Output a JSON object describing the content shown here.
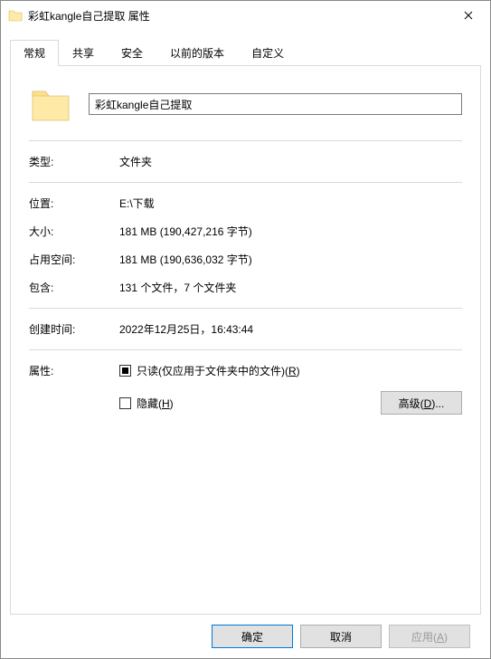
{
  "window": {
    "title": "彩虹kangle自己提取 属性"
  },
  "tabs": {
    "general": "常规",
    "share": "共享",
    "security": "安全",
    "previous": "以前的版本",
    "custom": "自定义"
  },
  "folder_name": "彩虹kangle自己提取",
  "labels": {
    "type": "类型:",
    "location": "位置:",
    "size": "大小:",
    "size_on_disk": "占用空间:",
    "contains": "包含:",
    "created": "创建时间:",
    "attributes": "属性:"
  },
  "values": {
    "type": "文件夹",
    "location": "E:\\下载",
    "size": "181 MB (190,427,216 字节)",
    "size_on_disk": "181 MB (190,636,032 字节)",
    "contains": "131 个文件，7 个文件夹",
    "created": "2022年12月25日，16:43:44"
  },
  "attributes": {
    "readonly_label_pre": "只读(仅应用于文件夹中的文件)(",
    "readonly_key": "R",
    "readonly_label_post": ")",
    "hidden_label_pre": "隐藏(",
    "hidden_key": "H",
    "hidden_label_post": ")",
    "advanced_pre": "高级(",
    "advanced_key": "D",
    "advanced_post": ")..."
  },
  "footer": {
    "ok": "确定",
    "cancel": "取消",
    "apply_pre": "应用(",
    "apply_key": "A",
    "apply_post": ")"
  }
}
